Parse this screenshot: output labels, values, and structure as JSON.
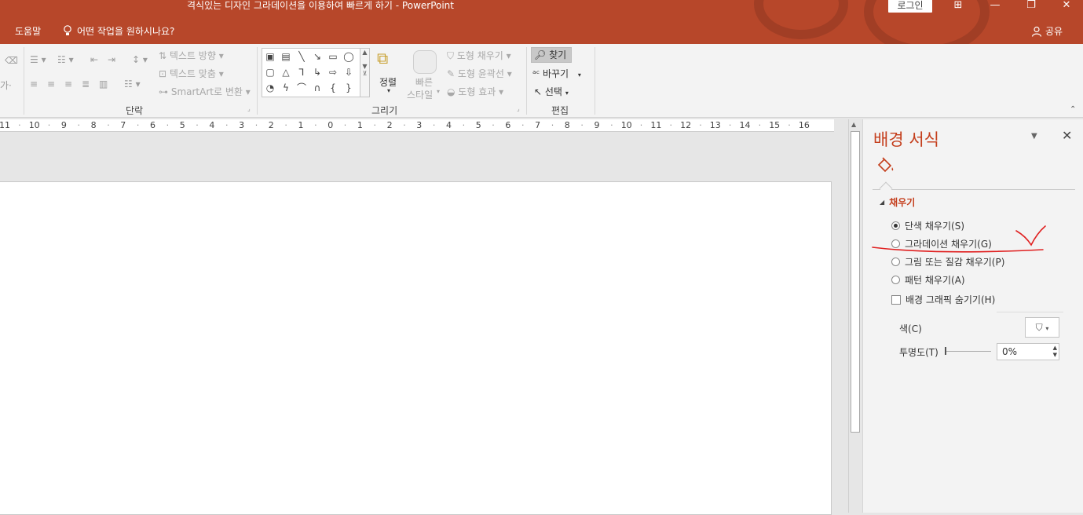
{
  "titlebar": {
    "title": "격식있는 디자인 그라데이션을 이용하여 빠르게 하기  -  PowerPoint",
    "login": "로그인",
    "help": "도움말",
    "tellme": "어떤 작업을 원하시나요?",
    "share": "공유"
  },
  "ribbon": {
    "paragraph": {
      "label": "단락",
      "text_direction": "텍스트 방향",
      "align_text": "텍스트 맞춤",
      "smartart": "SmartArt로 변환"
    },
    "drawing": {
      "label": "그리기",
      "arrange": "정렬",
      "quick_styles_1": "빠른",
      "quick_styles_2": "스타일",
      "shape_fill": "도형 채우기",
      "shape_outline": "도형 윤곽선",
      "shape_effects": "도형 효과"
    },
    "editing": {
      "label": "편집",
      "find": "찾기",
      "replace": "바꾸기",
      "select": "선택"
    }
  },
  "ruler": {
    "ticks": [
      "11",
      "10",
      "9",
      "8",
      "7",
      "6",
      "5",
      "4",
      "3",
      "2",
      "1",
      "0",
      "1",
      "2",
      "3",
      "4",
      "5",
      "6",
      "7",
      "8",
      "9",
      "10",
      "11",
      "12",
      "13",
      "14",
      "15",
      "16"
    ]
  },
  "pane": {
    "title": "배경 서식",
    "section": "채우기",
    "options": [
      {
        "label": "단색 채우기(S)",
        "selected": true
      },
      {
        "label": "그라데이션 채우기(G)",
        "selected": false
      },
      {
        "label": "그림 또는 질감 채우기(P)",
        "selected": false
      },
      {
        "label": "패턴 채우기(A)",
        "selected": false
      }
    ],
    "hide_graphics": "배경 그래픽 숨기기(H)",
    "color_label": "색(C)",
    "transparency_label": "투명도(T)",
    "transparency_value": "0%"
  },
  "colors": {
    "accent": "#b7472a",
    "pane_title": "#c43e1c",
    "annotation": "#e02020"
  }
}
